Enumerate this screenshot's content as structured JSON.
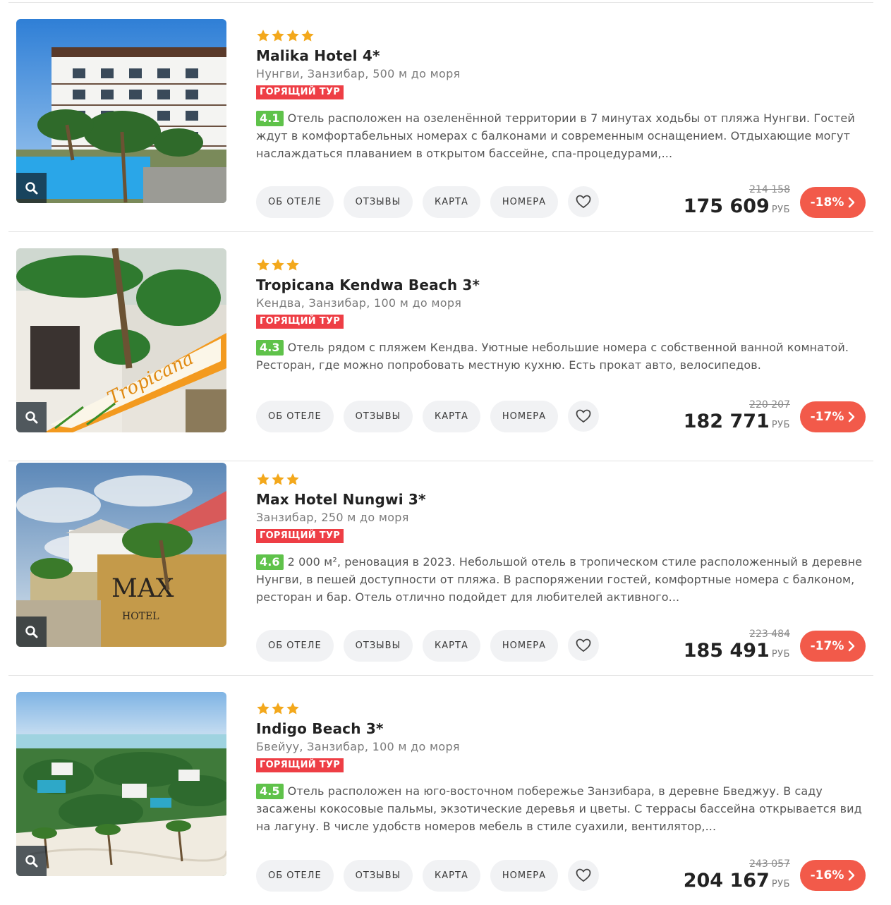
{
  "colors": {
    "hot_badge": "#ee3e45",
    "rating": "#5fc24a",
    "discount": "#f25a4a",
    "star": "#f3a81c"
  },
  "icons": {
    "zoom": "search-icon",
    "favorite": "heart-icon",
    "discount_arrow": "chevron-right-icon",
    "rating_star": "star-icon"
  },
  "buttons": {
    "about": "ОБ ОТЕЛЕ",
    "reviews": "ОТЗЫВЫ",
    "map": "КАРТА",
    "rooms": "НОМЕРА"
  },
  "currency": "РУБ",
  "hot_label": "ГОРЯЩИЙ ТУР",
  "hotels": [
    {
      "stars": 4,
      "name": "Malika Hotel 4*",
      "location": "Нунгви, Занзибар, 500 м до моря",
      "rating": "4.1",
      "description": "Отель расположен на озеленённой территории в 7 минутах ходьбы от пляжа Нунгви. Гостей ждут в комфортабельных номерах с балконами и современным оснащением. Отдыхающие могут наслаждаться плаванием в открытом бассейне, спа-процедурами,...",
      "old_price": "214 158",
      "price": "175 609",
      "discount": "-18%"
    },
    {
      "stars": 3,
      "name": "Tropicana Kendwa Beach 3*",
      "location": "Кендва, Занзибар, 100 м до моря",
      "rating": "4.3",
      "description": "Отель рядом с пляжем Кендва. Уютные небольшие номера с собственной ванной комнатой. Ресторан, где можно попробовать местную кухню. Есть прокат авто, велосипедов.",
      "old_price": "220 207",
      "price": "182 771",
      "discount": "-17%"
    },
    {
      "stars": 3,
      "name": "Max Hotel Nungwi 3*",
      "location": "Занзибар, 250 м до моря",
      "rating": "4.6",
      "description": "2 000 м², реновация в 2023. Небольшой отель в тропическом стиле расположенный в деревне Нунгви, в пешей доступности от пляжа. В распоряжении гостей, комфортные номера с балконом, ресторан и бар. Отель отлично подойдет для любителей активного...",
      "old_price": "223 484",
      "price": "185 491",
      "discount": "-17%"
    },
    {
      "stars": 3,
      "name": "Indigo Beach 3*",
      "location": "Бвейуу, Занзибар, 100 м до моря",
      "rating": "4.5",
      "description": "Отель расположен на юго-восточном побережье Занзибара, в деревне Бведжуу. В саду засажены кокосовые пальмы, экзотические деревья и цветы. С террасы бассейна открывается вид на лагуну. В числе удобств номеров мебель в стиле суахили, вентилятор,...",
      "old_price": "243 057",
      "price": "204 167",
      "discount": "-16%"
    }
  ]
}
